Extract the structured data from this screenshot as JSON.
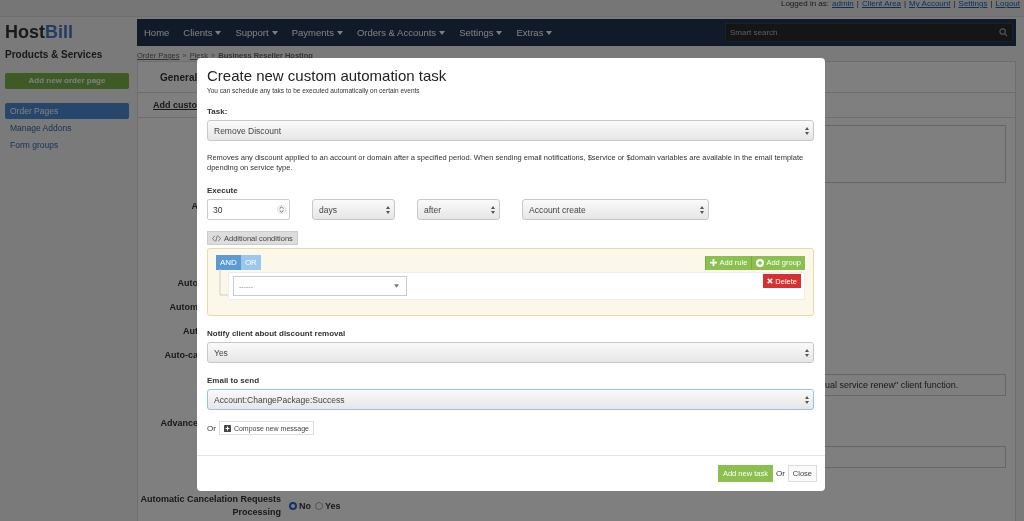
{
  "header": {
    "logged_in_label": "Logged in as:",
    "user": "admin",
    "separator": "|",
    "links": [
      "Client Area",
      "My Account",
      "Settings",
      "Logout"
    ]
  },
  "logo": {
    "first": "Host",
    "second": "Bill"
  },
  "sidebar": {
    "title": "Products & Services",
    "add_button": "Add new order page",
    "items": [
      {
        "label": "Order Pages",
        "selected": true
      },
      {
        "label": "Manage Addons",
        "selected": false
      },
      {
        "label": "Form groups",
        "selected": false
      }
    ]
  },
  "nav": {
    "items": [
      {
        "label": "Home",
        "dropdown": false
      },
      {
        "label": "Clients",
        "dropdown": true
      },
      {
        "label": "Support",
        "dropdown": true
      },
      {
        "label": "Payments",
        "dropdown": true
      },
      {
        "label": "Orders & Accounts",
        "dropdown": true
      },
      {
        "label": "Settings",
        "dropdown": true
      },
      {
        "label": "Extras",
        "dropdown": true
      }
    ],
    "search": {
      "placeholder": "Smart search"
    }
  },
  "breadcrumb": {
    "items": [
      "Order Pages",
      "Plesk",
      "Business Reseller Hosting"
    ],
    "separator": "»"
  },
  "content": {
    "tab": "General",
    "sublink": "Add custo",
    "labels": [
      "A",
      "Auto",
      "Autom",
      "Aut",
      "Auto-ca",
      "Advance"
    ],
    "note": "ual service renew\" client function.",
    "cancel_label": "Automatic Cancelation Requests Processing",
    "radios": [
      {
        "label": "No",
        "selected": true
      },
      {
        "label": "Yes",
        "selected": false
      }
    ]
  },
  "modal": {
    "title": "Create new custom automation task",
    "subtitle": "You can schedule any taks to be executed automatically on certain events",
    "task_label": "Task:",
    "task_value": "Remove Discount",
    "description": "Removes any discount applied to an account or domain after a specified period. When sending email notifications, $service or $domain variables are available in the email template dpending on service type.",
    "execute_label": "Execute",
    "execute": {
      "amount": "30",
      "unit": "days",
      "relation": "after",
      "event": "Account create"
    },
    "conditions_button": "Additional conditions",
    "logic": [
      {
        "label": "AND",
        "selected": true
      },
      {
        "label": "OR",
        "selected": false
      }
    ],
    "add_rule": "Add rule",
    "add_group": "Add group",
    "rule_value": "------",
    "delete": "Delete",
    "notify_label": "Notify client about discount removal",
    "notify_value": "Yes",
    "email_label": "Email to send",
    "email_value": "Account:ChangePackage:Success",
    "compose_or": "Or",
    "compose": "Compose new message",
    "submit": "Add new task",
    "footer_or": "Or",
    "close": "Close"
  }
}
